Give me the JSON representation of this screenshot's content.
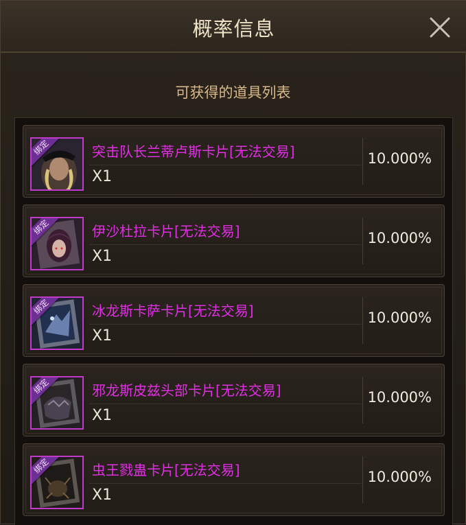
{
  "dialog": {
    "title": "概率信息",
    "subtitle": "可获得的道具列表",
    "close_icon": "close-icon"
  },
  "items": [
    {
      "bind_label": "绑定",
      "name": "突击队长兰蒂卢斯卡片[无法交易]",
      "quantity": "X1",
      "probability": "10.000%",
      "icon": "card-portrait-icon"
    },
    {
      "bind_label": "绑定",
      "name": "伊沙杜拉卡片[无法交易]",
      "quantity": "X1",
      "probability": "10.000%",
      "icon": "card-portrait-icon"
    },
    {
      "bind_label": "绑定",
      "name": "冰龙斯卡萨卡片[无法交易]",
      "quantity": "X1",
      "probability": "10.000%",
      "icon": "card-portrait-icon"
    },
    {
      "bind_label": "绑定",
      "name": "邪龙斯皮兹头部卡片[无法交易]",
      "quantity": "X1",
      "probability": "10.000%",
      "icon": "card-portrait-icon"
    },
    {
      "bind_label": "绑定",
      "name": "虫王戮蛊卡片[无法交易]",
      "quantity": "X1",
      "probability": "10.000%",
      "icon": "card-portrait-icon"
    }
  ],
  "colors": {
    "item_name": "#e22ee6",
    "bind_tag": "#6e2f94",
    "title": "#f0e3c8",
    "subtitle": "#d9b98a"
  }
}
